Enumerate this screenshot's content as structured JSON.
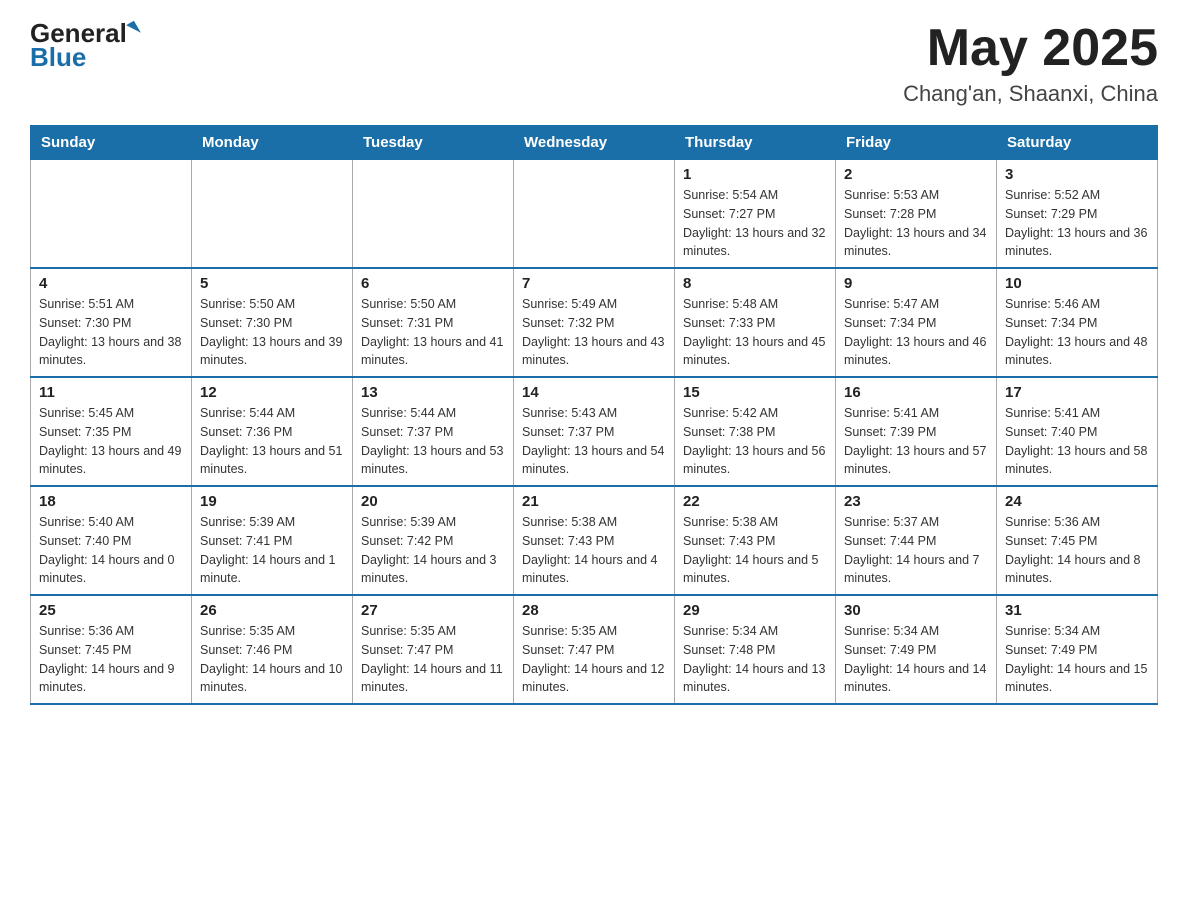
{
  "logo": {
    "general": "General",
    "blue": "Blue",
    "arrow": "▲"
  },
  "title": "May 2025",
  "subtitle": "Chang'an, Shaanxi, China",
  "days_of_week": [
    "Sunday",
    "Monday",
    "Tuesday",
    "Wednesday",
    "Thursday",
    "Friday",
    "Saturday"
  ],
  "weeks": [
    [
      {
        "day": "",
        "info": ""
      },
      {
        "day": "",
        "info": ""
      },
      {
        "day": "",
        "info": ""
      },
      {
        "day": "",
        "info": ""
      },
      {
        "day": "1",
        "info": "Sunrise: 5:54 AM\nSunset: 7:27 PM\nDaylight: 13 hours and 32 minutes."
      },
      {
        "day": "2",
        "info": "Sunrise: 5:53 AM\nSunset: 7:28 PM\nDaylight: 13 hours and 34 minutes."
      },
      {
        "day": "3",
        "info": "Sunrise: 5:52 AM\nSunset: 7:29 PM\nDaylight: 13 hours and 36 minutes."
      }
    ],
    [
      {
        "day": "4",
        "info": "Sunrise: 5:51 AM\nSunset: 7:30 PM\nDaylight: 13 hours and 38 minutes."
      },
      {
        "day": "5",
        "info": "Sunrise: 5:50 AM\nSunset: 7:30 PM\nDaylight: 13 hours and 39 minutes."
      },
      {
        "day": "6",
        "info": "Sunrise: 5:50 AM\nSunset: 7:31 PM\nDaylight: 13 hours and 41 minutes."
      },
      {
        "day": "7",
        "info": "Sunrise: 5:49 AM\nSunset: 7:32 PM\nDaylight: 13 hours and 43 minutes."
      },
      {
        "day": "8",
        "info": "Sunrise: 5:48 AM\nSunset: 7:33 PM\nDaylight: 13 hours and 45 minutes."
      },
      {
        "day": "9",
        "info": "Sunrise: 5:47 AM\nSunset: 7:34 PM\nDaylight: 13 hours and 46 minutes."
      },
      {
        "day": "10",
        "info": "Sunrise: 5:46 AM\nSunset: 7:34 PM\nDaylight: 13 hours and 48 minutes."
      }
    ],
    [
      {
        "day": "11",
        "info": "Sunrise: 5:45 AM\nSunset: 7:35 PM\nDaylight: 13 hours and 49 minutes."
      },
      {
        "day": "12",
        "info": "Sunrise: 5:44 AM\nSunset: 7:36 PM\nDaylight: 13 hours and 51 minutes."
      },
      {
        "day": "13",
        "info": "Sunrise: 5:44 AM\nSunset: 7:37 PM\nDaylight: 13 hours and 53 minutes."
      },
      {
        "day": "14",
        "info": "Sunrise: 5:43 AM\nSunset: 7:37 PM\nDaylight: 13 hours and 54 minutes."
      },
      {
        "day": "15",
        "info": "Sunrise: 5:42 AM\nSunset: 7:38 PM\nDaylight: 13 hours and 56 minutes."
      },
      {
        "day": "16",
        "info": "Sunrise: 5:41 AM\nSunset: 7:39 PM\nDaylight: 13 hours and 57 minutes."
      },
      {
        "day": "17",
        "info": "Sunrise: 5:41 AM\nSunset: 7:40 PM\nDaylight: 13 hours and 58 minutes."
      }
    ],
    [
      {
        "day": "18",
        "info": "Sunrise: 5:40 AM\nSunset: 7:40 PM\nDaylight: 14 hours and 0 minutes."
      },
      {
        "day": "19",
        "info": "Sunrise: 5:39 AM\nSunset: 7:41 PM\nDaylight: 14 hours and 1 minute."
      },
      {
        "day": "20",
        "info": "Sunrise: 5:39 AM\nSunset: 7:42 PM\nDaylight: 14 hours and 3 minutes."
      },
      {
        "day": "21",
        "info": "Sunrise: 5:38 AM\nSunset: 7:43 PM\nDaylight: 14 hours and 4 minutes."
      },
      {
        "day": "22",
        "info": "Sunrise: 5:38 AM\nSunset: 7:43 PM\nDaylight: 14 hours and 5 minutes."
      },
      {
        "day": "23",
        "info": "Sunrise: 5:37 AM\nSunset: 7:44 PM\nDaylight: 14 hours and 7 minutes."
      },
      {
        "day": "24",
        "info": "Sunrise: 5:36 AM\nSunset: 7:45 PM\nDaylight: 14 hours and 8 minutes."
      }
    ],
    [
      {
        "day": "25",
        "info": "Sunrise: 5:36 AM\nSunset: 7:45 PM\nDaylight: 14 hours and 9 minutes."
      },
      {
        "day": "26",
        "info": "Sunrise: 5:35 AM\nSunset: 7:46 PM\nDaylight: 14 hours and 10 minutes."
      },
      {
        "day": "27",
        "info": "Sunrise: 5:35 AM\nSunset: 7:47 PM\nDaylight: 14 hours and 11 minutes."
      },
      {
        "day": "28",
        "info": "Sunrise: 5:35 AM\nSunset: 7:47 PM\nDaylight: 14 hours and 12 minutes."
      },
      {
        "day": "29",
        "info": "Sunrise: 5:34 AM\nSunset: 7:48 PM\nDaylight: 14 hours and 13 minutes."
      },
      {
        "day": "30",
        "info": "Sunrise: 5:34 AM\nSunset: 7:49 PM\nDaylight: 14 hours and 14 minutes."
      },
      {
        "day": "31",
        "info": "Sunrise: 5:34 AM\nSunset: 7:49 PM\nDaylight: 14 hours and 15 minutes."
      }
    ]
  ]
}
